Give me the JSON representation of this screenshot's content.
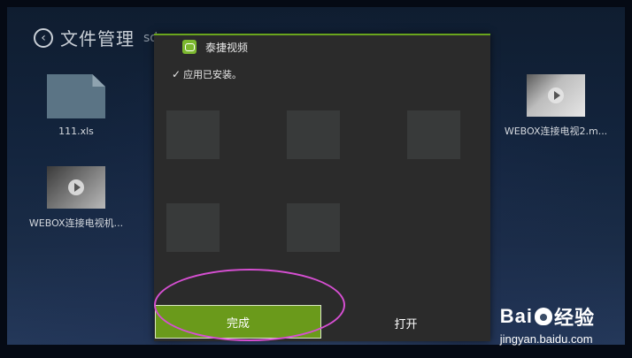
{
  "header": {
    "back_icon": "chevron-left-icon",
    "title": "文件管理",
    "subtitle": "sd"
  },
  "files": [
    {
      "name": "111.xls",
      "type": "document"
    },
    {
      "name": "WEBOX连接电视2.m...",
      "type": "video"
    },
    {
      "name": "WEBOX连接电视机...",
      "type": "video"
    }
  ],
  "dialog": {
    "app_name": "泰捷视频",
    "app_icon": "tv-app-icon",
    "message": "应用已安装。",
    "done_label": "完成",
    "open_label": "打开"
  },
  "watermark": {
    "brand": "Bai  经验",
    "url": "jingyan.baidu.com"
  },
  "colors": {
    "accent": "#6a9a1b",
    "highlight": "#d64fd2"
  }
}
